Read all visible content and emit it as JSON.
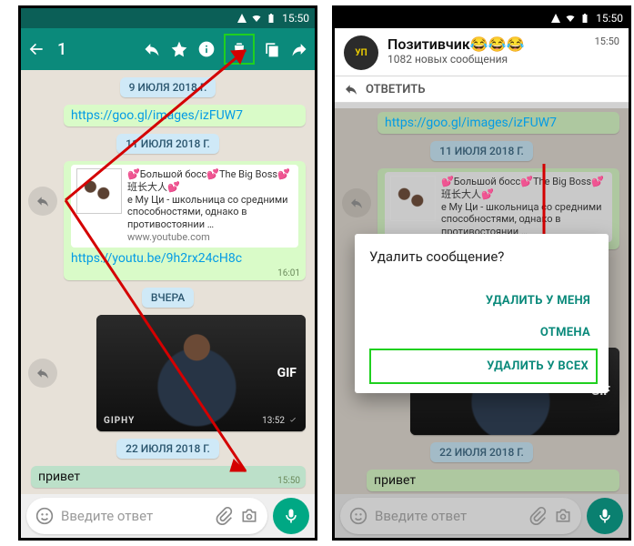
{
  "status": {
    "time": "15:50"
  },
  "left": {
    "selection_count": "1",
    "dates": {
      "d1": "9 ИЮЛЯ 2018 Г.",
      "d2": "11 ИЮЛЯ 2018 Г.",
      "d3": "ВЧЕРА",
      "d4": "22 ИЮЛЯ 2018 Г."
    },
    "msg_link1": "https://goo.gl/images/izFUW7",
    "card": {
      "title": "💕Большой босс💕The Big Boss💕班长大人💕",
      "desc": "е Му Ци - школьница со средними способностями, однако в противостоянии …",
      "domain": "www.youtube.com"
    },
    "msg_link2": "https://youtu.be/9h2rx24cH8c",
    "msg_link2_time": "16:01",
    "gif": {
      "label": "GIF",
      "brand": "GIPHY",
      "time": "13:52"
    },
    "msg_hi": "привет",
    "msg_hi_time": "15:50",
    "input_placeholder": "Введите ответ"
  },
  "right": {
    "header": {
      "title": "Позитивчик😂😂😂",
      "sub": "1082 новых сообщения",
      "time": "15:50",
      "reply": "ОТВЕТИТЬ"
    },
    "msg_link1": "https://goo.gl/images/izFUW7",
    "date2": "11 ИЮЛЯ 2018 Г.",
    "card": {
      "title": "💕Большой босс💕The Big Boss💕班长大人💕",
      "desc": "е Му Ци - школьница со средними способностями, однако в противостоянии …"
    },
    "dialog": {
      "title": "Удалить сообщение?",
      "btn_me": "УДАЛИТЬ У МЕНЯ",
      "btn_cancel": "ОТМЕНА",
      "btn_all": "УДАЛИТЬ У ВСЕХ"
    },
    "gif": {
      "label": "GIF"
    },
    "date4": "22 ИЮЛЯ 2018 Г.",
    "msg_hi": "привет",
    "input_placeholder": "Введите ответ"
  }
}
